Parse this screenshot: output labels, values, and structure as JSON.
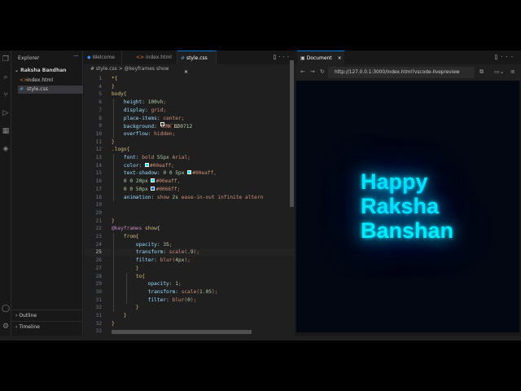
{
  "explorer": {
    "title": "Explorer",
    "folder": "Raksha Bandhan",
    "files": [
      {
        "name": "index.html",
        "icon": "<>"
      },
      {
        "name": "style.css",
        "icon": "#"
      }
    ],
    "sections": [
      "Outline",
      "Timeline"
    ]
  },
  "editor": {
    "tabs": [
      {
        "label": "Welcome"
      },
      {
        "label": "index.html"
      },
      {
        "label": "style.css"
      }
    ],
    "breadcrumb": "# style.css > @keyframes show",
    "lines": [
      {
        "n": "1",
        "text": "*{"
      },
      {
        "n": "4",
        "text": "}"
      },
      {
        "n": "5",
        "text": "body{"
      },
      {
        "n": "6",
        "text": "    height: 100vh;"
      },
      {
        "n": "7",
        "text": "    display: grid;"
      },
      {
        "n": "8",
        "text": "    place-items: center;"
      },
      {
        "n": "9",
        "text": "    background: #030712;"
      },
      {
        "n": "10",
        "text": "    overflow: hidden;"
      },
      {
        "n": "11",
        "text": "}"
      },
      {
        "n": "12",
        "text": ".logo{"
      },
      {
        "n": "13",
        "text": "    font: bold 55px Arial;"
      },
      {
        "n": "14",
        "text": "    color: #00eaff;"
      },
      {
        "n": "15",
        "text": "    text-shadow: 0 0 5px #00eaff,"
      },
      {
        "n": "16",
        "text": "    0 0 20px #00eaff,"
      },
      {
        "n": "17",
        "text": "    0 0 50px #0066ff;"
      },
      {
        "n": "18",
        "text": "    animation: show 2s ease-in-out infinite altern"
      },
      {
        "n": "19",
        "text": ""
      },
      {
        "n": "20",
        "text": ""
      },
      {
        "n": "21",
        "text": "}"
      },
      {
        "n": "22",
        "text": "@keyframes show{"
      },
      {
        "n": "23",
        "text": "    from{"
      },
      {
        "n": "24",
        "text": "        opacity: 35;"
      },
      {
        "n": "25",
        "text": "        transform: scale(.9);"
      },
      {
        "n": "26",
        "text": "        filter: blur(4px);"
      },
      {
        "n": "27",
        "text": "        }"
      },
      {
        "n": "28",
        "text": "        to{"
      },
      {
        "n": "29",
        "text": "            opacity: 1;"
      },
      {
        "n": "30",
        "text": "            transform: scale(1.05);"
      },
      {
        "n": "31",
        "text": "            filter: blur(0);"
      },
      {
        "n": "32",
        "text": "        }"
      },
      {
        "n": "31",
        "text": "    }"
      },
      {
        "n": "32",
        "text": "}"
      },
      {
        "n": "33",
        "text": ""
      }
    ],
    "current_line": "25"
  },
  "preview": {
    "tab": "Document",
    "url": "http://127.0.0.1:3000/index.html?vscode-livepreview",
    "logo_lines": [
      "Happy",
      "Raksha",
      "Banshan"
    ]
  },
  "colors": {
    "accent": "#0078d4",
    "logo": "#00eaff",
    "logo_glow": "#0066ff",
    "page_bg": "#030712"
  }
}
